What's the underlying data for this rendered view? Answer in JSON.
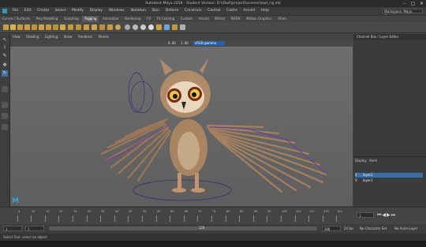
{
  "window": {
    "title": "Autodesk Maya 2018 - Student Version: D:\\\\Owl\\\\project\\\\scenes\\\\owl_rig.mb",
    "controls": [
      "–",
      "□",
      "×"
    ]
  },
  "menubar": {
    "items": [
      "File",
      "Edit",
      "Create",
      "Select",
      "Modify",
      "Display",
      "Windows",
      "Skeleton",
      "Skin",
      "Deform",
      "Constrain",
      "Control",
      "Cache",
      "Arnold",
      "Help"
    ],
    "workspace_label": "Workspace: Maya Classic"
  },
  "shelf": {
    "tabs": [
      "Curves / Surfaces",
      "Poly Modeling",
      "Sculpting",
      "Rigging",
      "Animation",
      "Rendering",
      "FX",
      "FX Caching",
      "Custom",
      "Arnold",
      "Bifrost",
      "MASH",
      "Motion Graphics",
      "XGen"
    ]
  },
  "viewport": {
    "menu": [
      "View",
      "Shading",
      "Lighting",
      "Show",
      "Renderer",
      "Panels"
    ],
    "camera_field": "sRGB gamma",
    "exposure": "0.00",
    "gamma": "1.00",
    "logo": "M"
  },
  "right_panel": {
    "tabs": [
      "Channel Box / Layer Editor"
    ],
    "layer_tabs": [
      "Display",
      "Anim"
    ],
    "layers": [
      {
        "vis": "V",
        "name": "layer2"
      },
      {
        "vis": "V",
        "name": "layer1"
      }
    ]
  },
  "timeline": {
    "ticks": [
      "5",
      "10",
      "15",
      "20",
      "25",
      "30",
      "35",
      "40",
      "45",
      "50",
      "55",
      "60",
      "65",
      "70",
      "75",
      "80",
      "85",
      "90",
      "95",
      "100",
      "105",
      "110",
      "115",
      "120"
    ],
    "current_frame": "1"
  },
  "range": {
    "start": "1",
    "inner_start": "1",
    "inner_end": "120",
    "end": "200",
    "fps": "24 fps",
    "character": "No Character Set",
    "anim_layer": "No Anim Layer"
  },
  "helpline": {
    "text": "Select Tool: select an object"
  },
  "colors": {
    "selection_blue": "#3a6ea5",
    "body_brown": "#a88462",
    "rig_purple": "#6a3aa8"
  }
}
